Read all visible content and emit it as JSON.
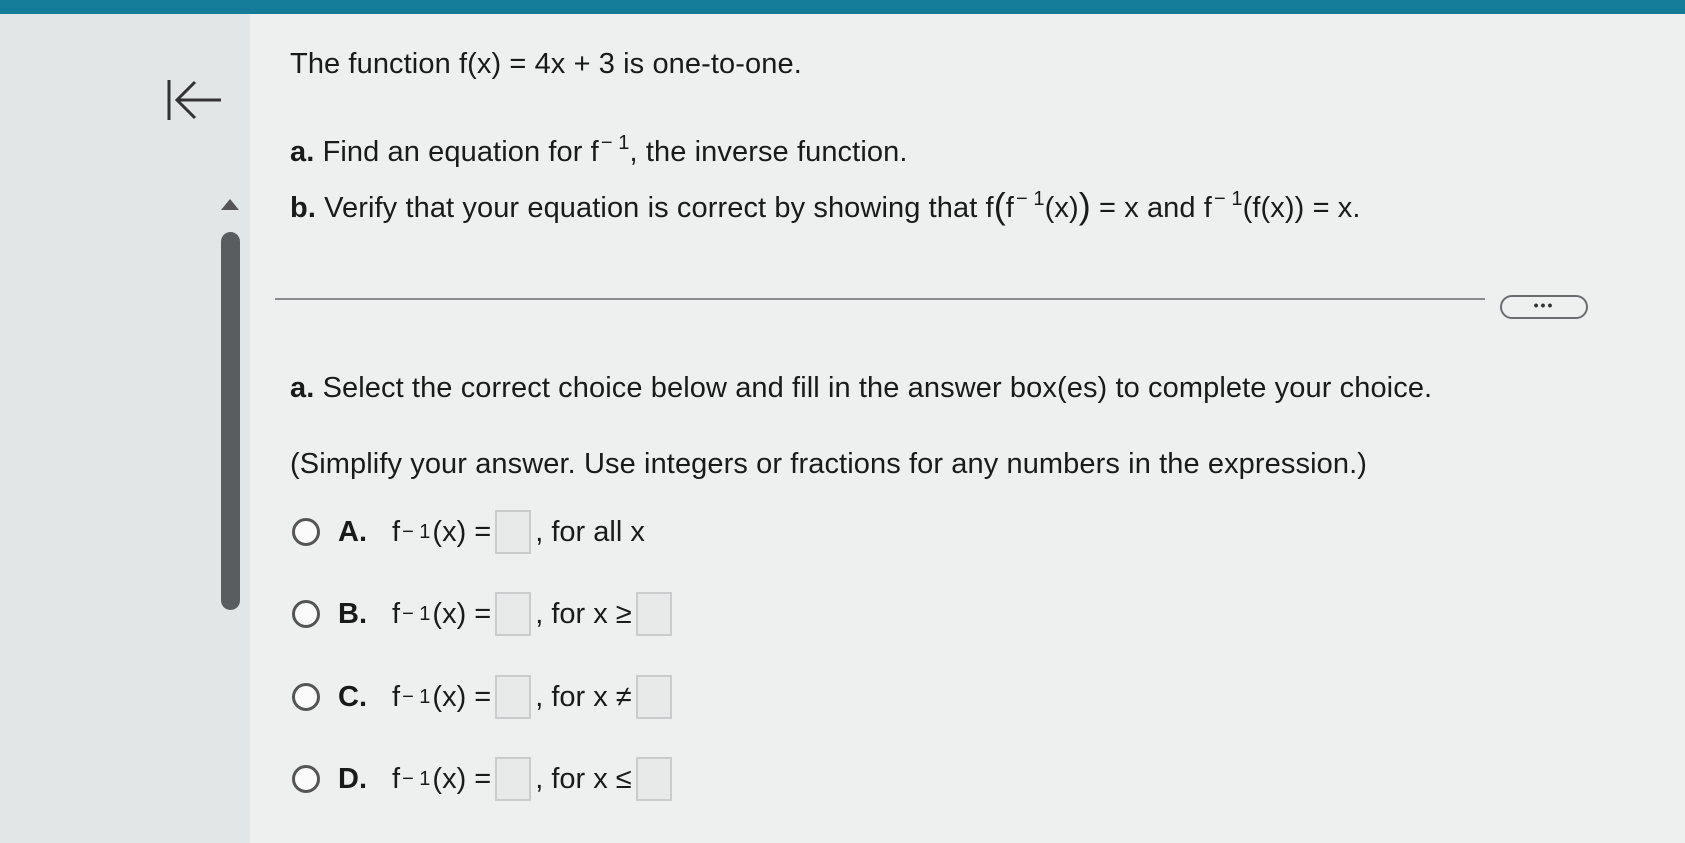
{
  "problem": {
    "statement": "The function f(x) = 4x + 3 is one-to-one.",
    "part_a_label": "a.",
    "part_a_pre": "Find an equation for f",
    "part_a_sup": "− 1",
    "part_a_post": ", the inverse function.",
    "part_b_label": "b.",
    "part_b_pre": "Verify that your equation is correct by showing that f",
    "part_b_open": "(",
    "part_b_f": "f",
    "part_b_sup1": "− 1",
    "part_b_mid1": "(x)",
    "part_b_close": ")",
    "part_b_mid2": " = x and f",
    "part_b_sup2": "− 1",
    "part_b_post": "(f(x)) = x."
  },
  "more_button": "•••",
  "answer": {
    "instruction_label": "a.",
    "instruction": "Select the correct choice below and fill in the answer box(es) to complete your choice.",
    "note": "(Simplify your answer. Use integers or fractions for any numbers in the expression.)"
  },
  "choices": [
    {
      "letter": "A.",
      "func": "f",
      "sup": "− 1",
      "eq": "(x) =",
      "cond": ", for all x",
      "second_box": false
    },
    {
      "letter": "B.",
      "func": "f",
      "sup": "− 1",
      "eq": "(x) =",
      "cond": ", for x ≥",
      "second_box": true
    },
    {
      "letter": "C.",
      "func": "f",
      "sup": "− 1",
      "eq": "(x) =",
      "cond": ", for x ≠",
      "second_box": true
    },
    {
      "letter": "D.",
      "func": "f",
      "sup": "− 1",
      "eq": "(x) =",
      "cond": ", for x ≤",
      "second_box": true
    }
  ],
  "icons": {
    "back": "first-page-icon",
    "scroll_up": "triangle-up-icon"
  },
  "colors": {
    "topbar": "#147c98",
    "scrollbar": "#5a5d5f"
  }
}
